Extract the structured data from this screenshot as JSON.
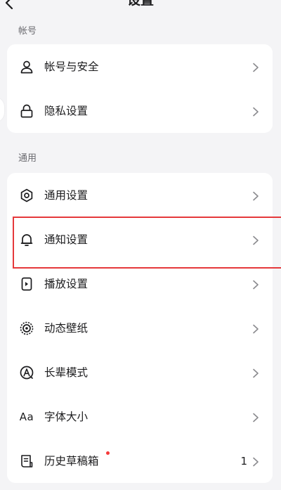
{
  "header": {
    "title": "设置"
  },
  "sections": [
    {
      "label": "帐号",
      "items": [
        {
          "label": "帐号与安全",
          "icon": "user-icon"
        },
        {
          "label": "隐私设置",
          "icon": "lock-icon"
        }
      ]
    },
    {
      "label": "通用",
      "items": [
        {
          "label": "通用设置",
          "icon": "gear-icon"
        },
        {
          "label": "通知设置",
          "icon": "bell-icon"
        },
        {
          "label": "播放设置",
          "icon": "play-settings-icon"
        },
        {
          "label": "动态壁纸",
          "icon": "dynamic-wallpaper-icon"
        },
        {
          "label": "长辈模式",
          "icon": "elder-mode-icon"
        },
        {
          "label": "字体大小",
          "icon": "font-size-icon",
          "glyph": "Aa"
        },
        {
          "label": "历史草稿箱",
          "icon": "drafts-icon",
          "value": "1",
          "badge": "red-dot"
        }
      ]
    }
  ],
  "colors": {
    "background": "#f4f4f6",
    "card": "#ffffff",
    "text": "#1c1c1e",
    "secondary_text": "#6b6b70",
    "highlight": "#e5393b",
    "badge": "#f53a3a"
  }
}
